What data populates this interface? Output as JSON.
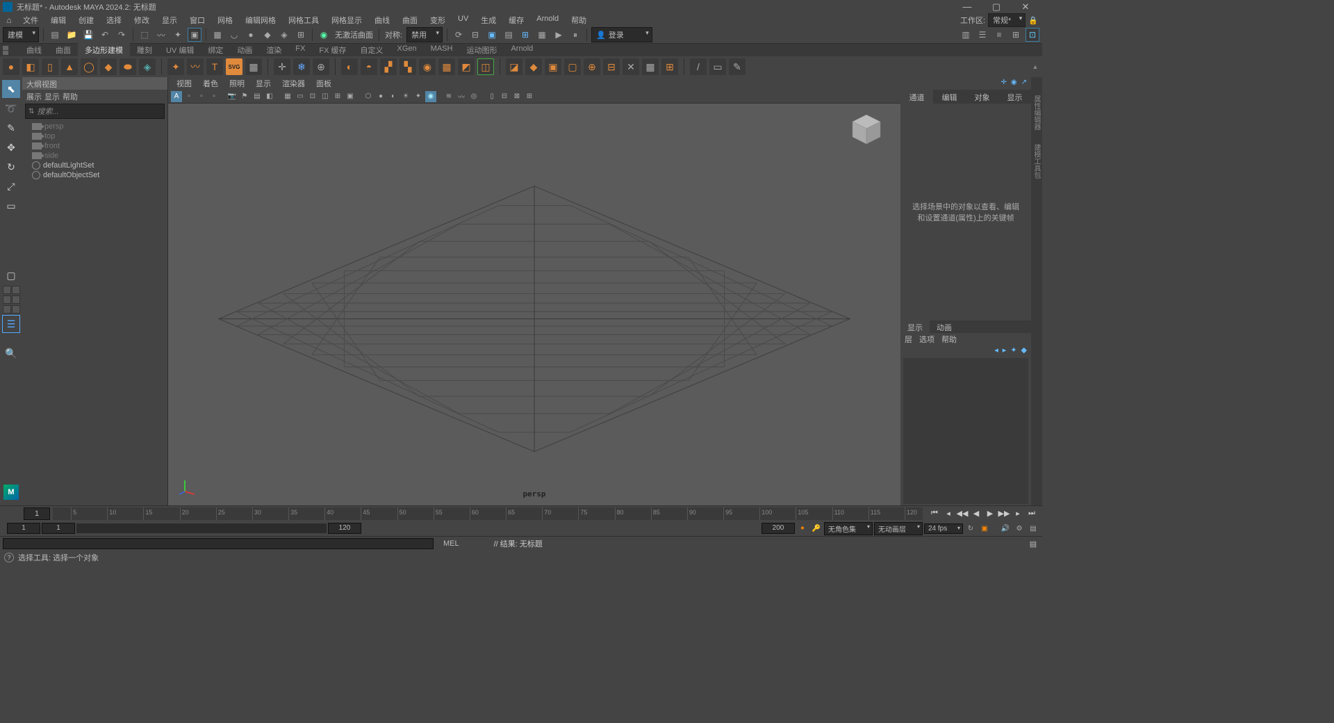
{
  "title": "无标题* - Autodesk MAYA 2024.2: 无标题",
  "menu": [
    "文件",
    "编辑",
    "创建",
    "选择",
    "修改",
    "显示",
    "窗口",
    "网格",
    "编辑网格",
    "网格工具",
    "网格显示",
    "曲线",
    "曲面",
    "变形",
    "UV",
    "生成",
    "缓存",
    "Arnold",
    "帮助"
  ],
  "workspace_label": "工作区:",
  "workspace_value": "常规*",
  "mode_dd": "建模",
  "status_obj_label": "对称:",
  "status_obj_value": "禁用",
  "no_active_surface": "无激活曲面",
  "login_label": "登录",
  "shelf_tabs": [
    "曲线",
    "曲面",
    "多边形建模",
    "雕刻",
    "UV 编辑",
    "绑定",
    "动画",
    "渲染",
    "FX",
    "FX 缓存",
    "自定义",
    "XGen",
    "MASH",
    "运动图形",
    "Arnold"
  ],
  "shelf_active": 2,
  "outliner_title": "大纲视图",
  "outliner_menus": [
    "展示",
    "显示",
    "帮助"
  ],
  "outliner_search": "搜索...",
  "outliner_items": [
    {
      "label": "persp",
      "type": "cam",
      "dim": true
    },
    {
      "label": "top",
      "type": "cam",
      "dim": true
    },
    {
      "label": "front",
      "type": "cam",
      "dim": true
    },
    {
      "label": "side",
      "type": "cam",
      "dim": true
    },
    {
      "label": "defaultLightSet",
      "type": "set",
      "dim": false
    },
    {
      "label": "defaultObjectSet",
      "type": "set",
      "dim": false
    }
  ],
  "vp_menus": [
    "视图",
    "着色",
    "照明",
    "显示",
    "渲染器",
    "面板"
  ],
  "persp_label": "persp",
  "channel_tabs": [
    "通道",
    "编辑",
    "对象",
    "显示"
  ],
  "channel_hint": "选择场景中的对象以查看、编辑和设置通道(属性)上的关键帧",
  "display_tabs": [
    "显示",
    "动画"
  ],
  "layer_menus": [
    "层",
    "选项",
    "帮助"
  ],
  "time_frame_start": "1",
  "time_ticks": [
    "5",
    "10",
    "15",
    "20",
    "25",
    "30",
    "35",
    "40",
    "45",
    "50",
    "55",
    "60",
    "65",
    "70",
    "75",
    "80",
    "85",
    "90",
    "95",
    "100",
    "105",
    "110",
    "115",
    "120"
  ],
  "range_start_outer": "1",
  "range_start_inner": "1",
  "range_end_inner": "120",
  "range_end_outer": "200",
  "no_char_set": "无角色集",
  "no_anim_layer": "无动画层",
  "fps": "24 fps",
  "mel": "MEL",
  "result": "// 结果: 无标题",
  "help_text": "选择工具: 选择一个对象",
  "side_tabs": [
    "建模工具包",
    "属性编辑器"
  ]
}
